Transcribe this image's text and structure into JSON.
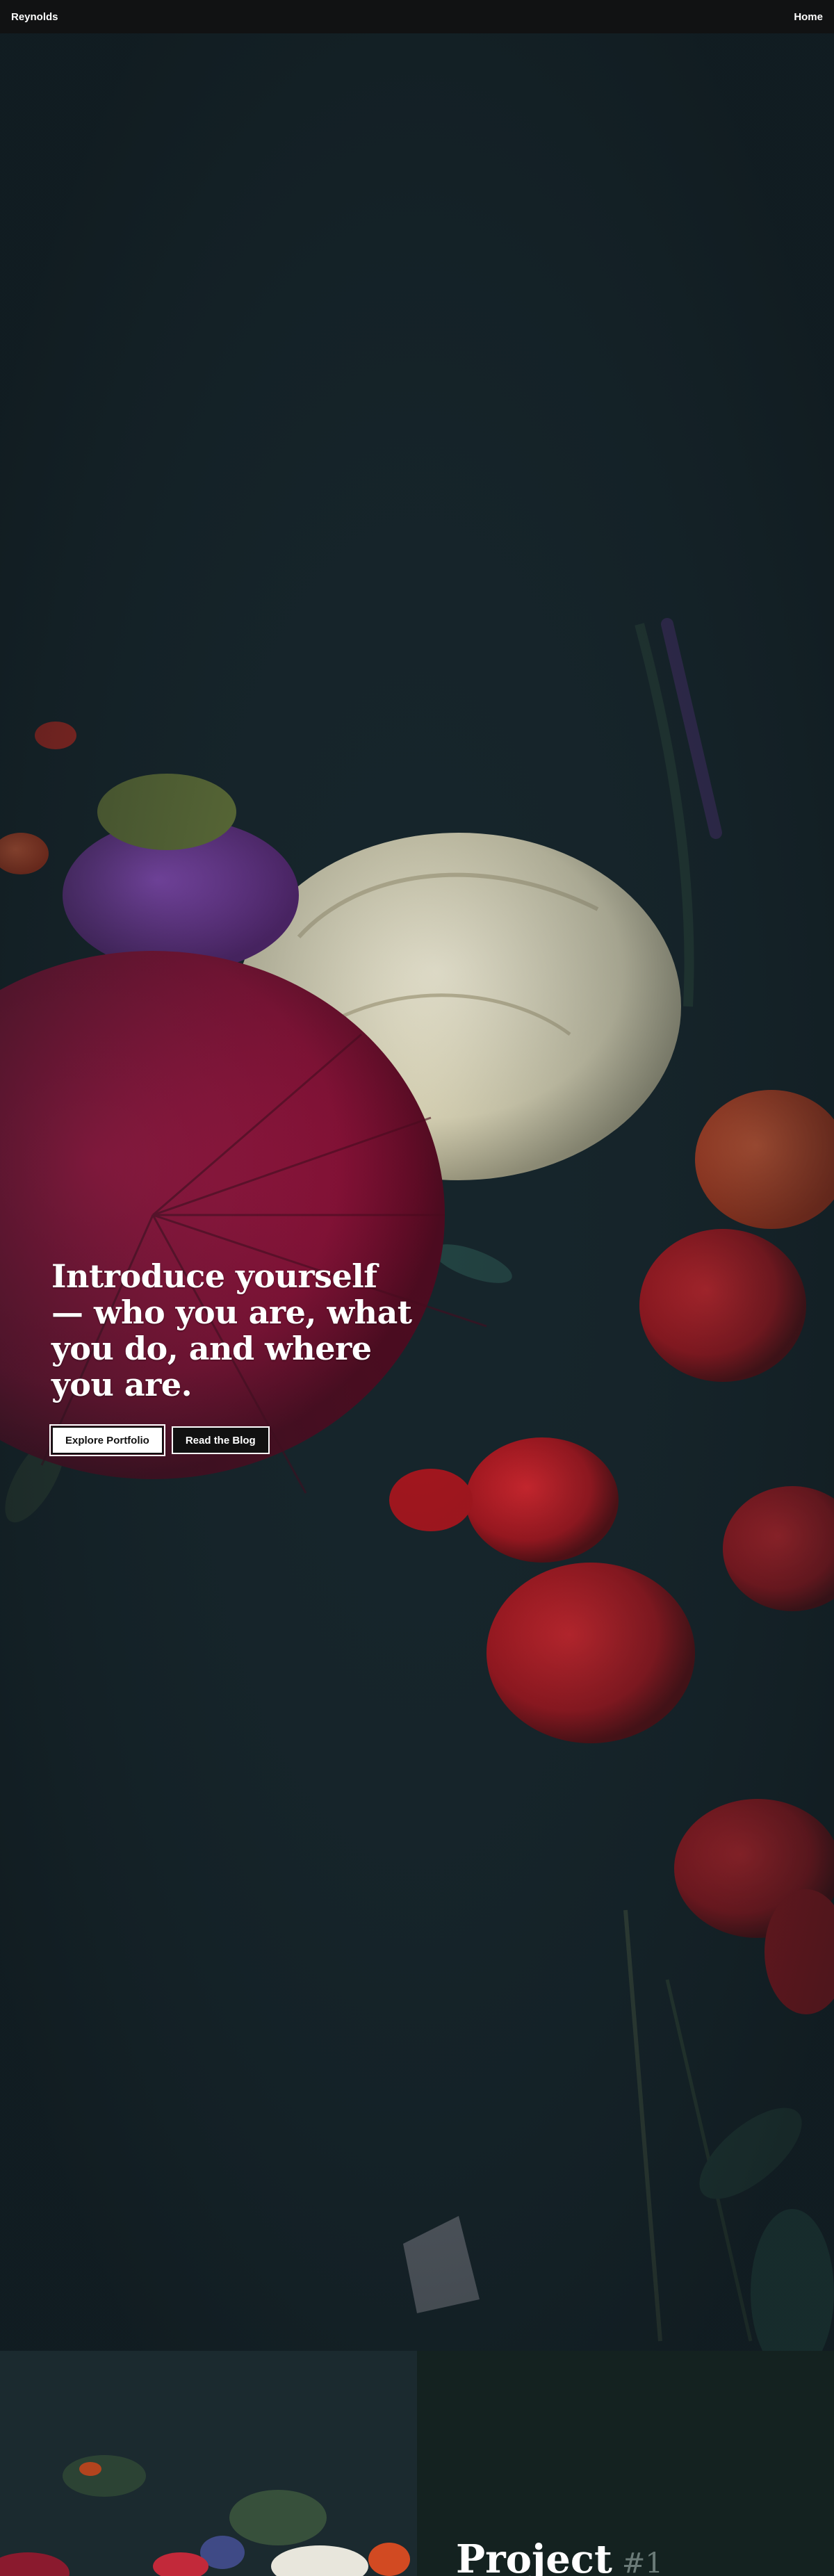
{
  "header": {
    "brand": "Reynolds",
    "nav": [
      "Home"
    ]
  },
  "hero": {
    "headline": "Introduce yourself — who you are, what you do, and where you are.",
    "buttons": {
      "primary": "Explore Portfolio",
      "secondary": "Read the Blog"
    }
  },
  "projects": [
    {
      "title": "Project",
      "number": "#1"
    }
  ],
  "colors": {
    "topbar": "#111213",
    "background": "#16252b",
    "project_panel": "#142220"
  }
}
